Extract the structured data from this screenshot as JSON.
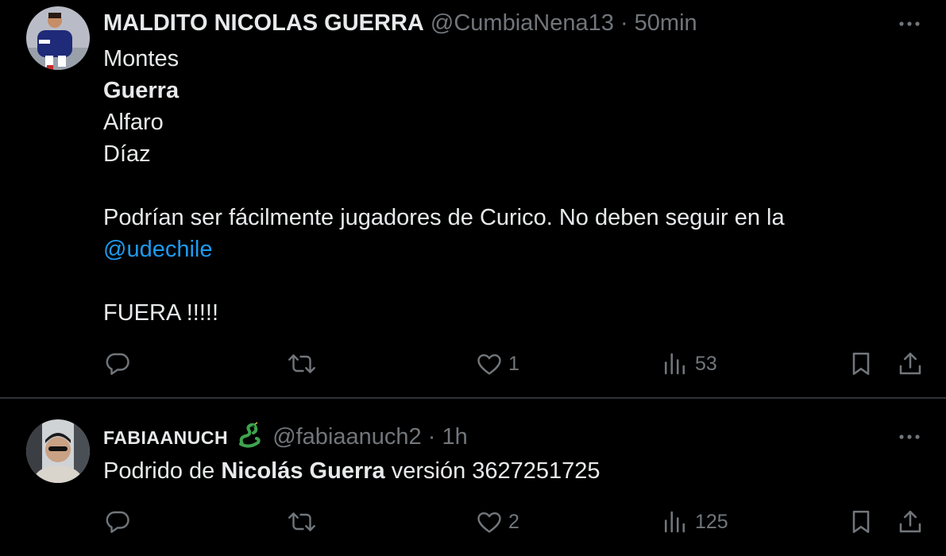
{
  "tweets": [
    {
      "display_name": "MALDITO NICOLAS GUERRA",
      "handle": "@CumbiaNena13",
      "separator": "·",
      "time": "50min",
      "body": {
        "line1": "Montes",
        "line2": "Guerra",
        "line3": "Alfaro",
        "line4": "Díaz",
        "line5": "Podrían ser fácilmente jugadores de Curico. No deben seguir en la",
        "mention": "@udechile",
        "line6": "FUERA !!!!!"
      },
      "actions": {
        "reply_count": "",
        "retweet_count": "",
        "like_count": "1",
        "view_count": "53"
      }
    },
    {
      "display_name": "FABIAANUCH",
      "badge_icon": "dragon-emoji",
      "handle": "@fabiaanuch2",
      "separator": "·",
      "time": "1h",
      "body": {
        "prefix": "Podrido de ",
        "bold": "Nicolás Guerra",
        "suffix": " versión 3627251725"
      },
      "actions": {
        "reply_count": "",
        "retweet_count": "",
        "like_count": "2",
        "view_count": "125"
      }
    }
  ],
  "colors": {
    "background": "#000000",
    "text": "#e7e9ea",
    "secondary": "#71767b",
    "link": "#1d9bf0",
    "divider": "#2f3336"
  }
}
